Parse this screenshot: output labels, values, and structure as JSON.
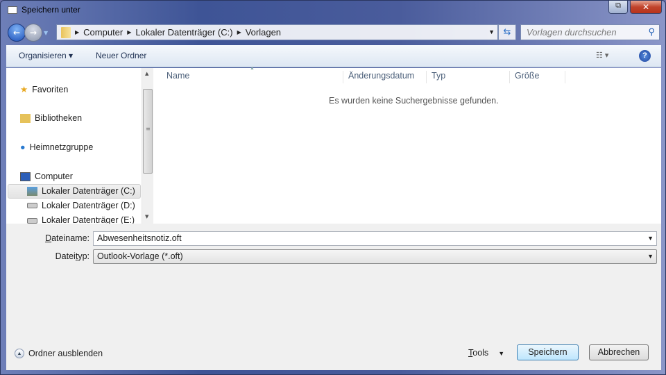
{
  "window": {
    "title": "Speichern unter",
    "minimize_icon": "restore-icon",
    "close_label": "✕"
  },
  "address": {
    "crumbs": [
      "Computer",
      "Lokaler Datenträger (C:)",
      "Vorlagen"
    ]
  },
  "search": {
    "placeholder": "Vorlagen durchsuchen"
  },
  "toolbar": {
    "organize": "Organisieren ▾",
    "new_folder": "Neuer Ordner",
    "help": "?"
  },
  "sidebar": {
    "items": [
      "Favoriten",
      "Bibliotheken",
      "Heimnetzgruppe",
      "Computer"
    ],
    "drives": [
      "Lokaler Datenträger (C:)",
      "Lokaler Datenträger (D:)",
      "Lokaler Datenträger (E:)"
    ]
  },
  "columns": [
    "Name",
    "Änderungsdatum",
    "Typ",
    "Größe"
  ],
  "empty_message": "Es wurden keine Suchergebnisse gefunden.",
  "form": {
    "filename_label_u": "D",
    "filename_label_rest": "ateiname:",
    "filename": "Abwesenheitsnotiz.oft",
    "filetype_label_a": "Datei",
    "filetype_label_u": "t",
    "filetype_label_b": "yp:",
    "filetype": "Outlook-Vorlage (*.oft)"
  },
  "footer": {
    "hide_folders": "Ordner ausblenden",
    "tools_u": "T",
    "tools_rest": "ools",
    "save": "Speichern",
    "cancel": "Abbrechen"
  }
}
